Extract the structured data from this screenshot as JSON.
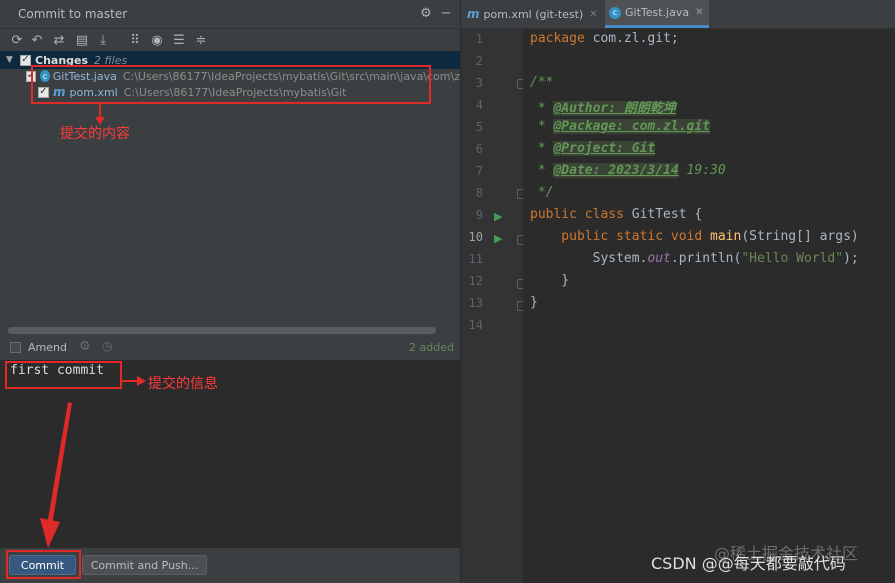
{
  "window": {
    "title": "Commit to master"
  },
  "toolbar": {
    "icons": [
      "refresh-icon",
      "rollback-icon",
      "diff-icon",
      "group-icon",
      "shelve-icon",
      "group-by-icon",
      "eye-icon",
      "expand-all-icon",
      "collapse-all-icon"
    ]
  },
  "changes": {
    "label": "Changes",
    "count": "2 files",
    "files": [
      {
        "name": "GitTest.java",
        "path": "C:\\Users\\86177\\IdeaProjects\\mybatis\\Git\\src\\main\\java\\com\\z",
        "icon": "c"
      },
      {
        "name": "pom.xml",
        "path": "C:\\Users\\86177\\IdeaProjects\\mybatis\\Git",
        "icon": "m"
      }
    ]
  },
  "annotations": {
    "content": "提交的内容",
    "message": "提交的信息"
  },
  "amend": {
    "label": "Amend",
    "status": "2 added"
  },
  "commit_message": "first commit",
  "buttons": {
    "commit": "Commit",
    "commit_push": "Commit and Push..."
  },
  "editor": {
    "tabs": [
      {
        "label": "pom.xml (git-test)",
        "icon": "m"
      },
      {
        "label": "GitTest.java",
        "icon": "c"
      }
    ],
    "line_numbers": [
      "1",
      "2",
      "3",
      "4",
      "5",
      "6",
      "7",
      "8",
      "9",
      "10",
      "11",
      "12",
      "13",
      "14"
    ],
    "code": {
      "l1_kw": "package",
      "l1_rest": " com.zl.git;",
      "l3": "/**",
      "l4_pre": " * ",
      "l4_tag": "@Author: 朗朗乾坤",
      "l5_pre": " * ",
      "l5_tag": "@Package: com.zl.git",
      "l6_pre": " * ",
      "l6_tag": "@Project: Git",
      "l7_pre": " * ",
      "l7_tag": "@Date: 2023/3/14",
      "l7_rest": " 19:30",
      "l8": " */",
      "l9_kw": "public class",
      "l9_rest": " GitTest {",
      "l10_kw": "    public static void",
      "l10_fn": " main",
      "l10_rest": "(String[] args)",
      "l11_pre": "        System.",
      "l11_fld": "out",
      "l11_mid": ".println(",
      "l11_str": "\"Hello World\"",
      "l11_end": ");",
      "l12": "    }",
      "l13": "}"
    }
  },
  "watermark": {
    "csdn": "CSDN @@每天都要敲代码",
    "juejin": "@稀土掘金技术社区"
  }
}
